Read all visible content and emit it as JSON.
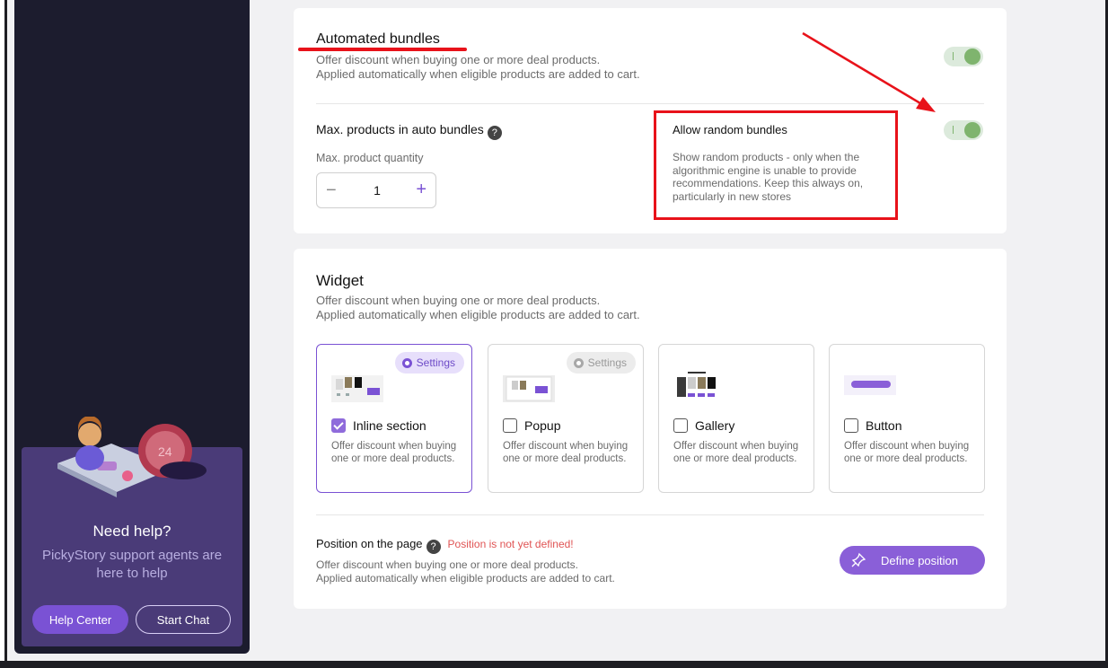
{
  "sidebar": {
    "help": {
      "title": "Need help?",
      "subtitle": "PickyStory support agents are here to help",
      "help_center_label": "Help Center",
      "start_chat_label": "Start Chat"
    }
  },
  "auto_bundles": {
    "title": "Automated bundles",
    "desc_line1": "Offer discount when buying one or more deal products.",
    "desc_line2": "Applied automatically when eligible products are added to cart.",
    "enabled": true,
    "max_products_label": "Max. products in auto bundles",
    "max_quantity_label": "Max. product quantity",
    "max_quantity_value": "1",
    "random_title": "Allow random bundles",
    "random_desc": "Show random products - only when the algorithmic engine is unable to provide recommendations. Keep this always on, particularly in new stores",
    "random_enabled": true
  },
  "widget": {
    "title": "Widget",
    "desc_line1": "Offer discount when buying one or more deal products.",
    "desc_line2": "Applied automatically when eligible products are added to cart.",
    "options": [
      {
        "label": "Inline section",
        "desc": "Offer discount when buying one or more deal products.",
        "checked": true,
        "settings_label": "Settings"
      },
      {
        "label": "Popup",
        "desc": "Offer discount when buying one or more deal products.",
        "checked": false,
        "settings_label": "Settings"
      },
      {
        "label": "Gallery",
        "desc": "Offer discount when buying one or more deal products.",
        "checked": false
      },
      {
        "label": "Button",
        "desc": "Offer discount when buying one or more deal products.",
        "checked": false
      }
    ],
    "position": {
      "label": "Position on the page",
      "warning": "Position is not yet defined!",
      "desc_line1": "Offer discount when buying one or more deal products.",
      "desc_line2": "Applied automatically when eligible products are added to cart.",
      "button_label": "Define position"
    }
  },
  "colors": {
    "accent": "#7a52d4",
    "annotation": "#e8121a",
    "toggle_on": "#7fb46e",
    "sidebar": "#1c1c2e"
  }
}
